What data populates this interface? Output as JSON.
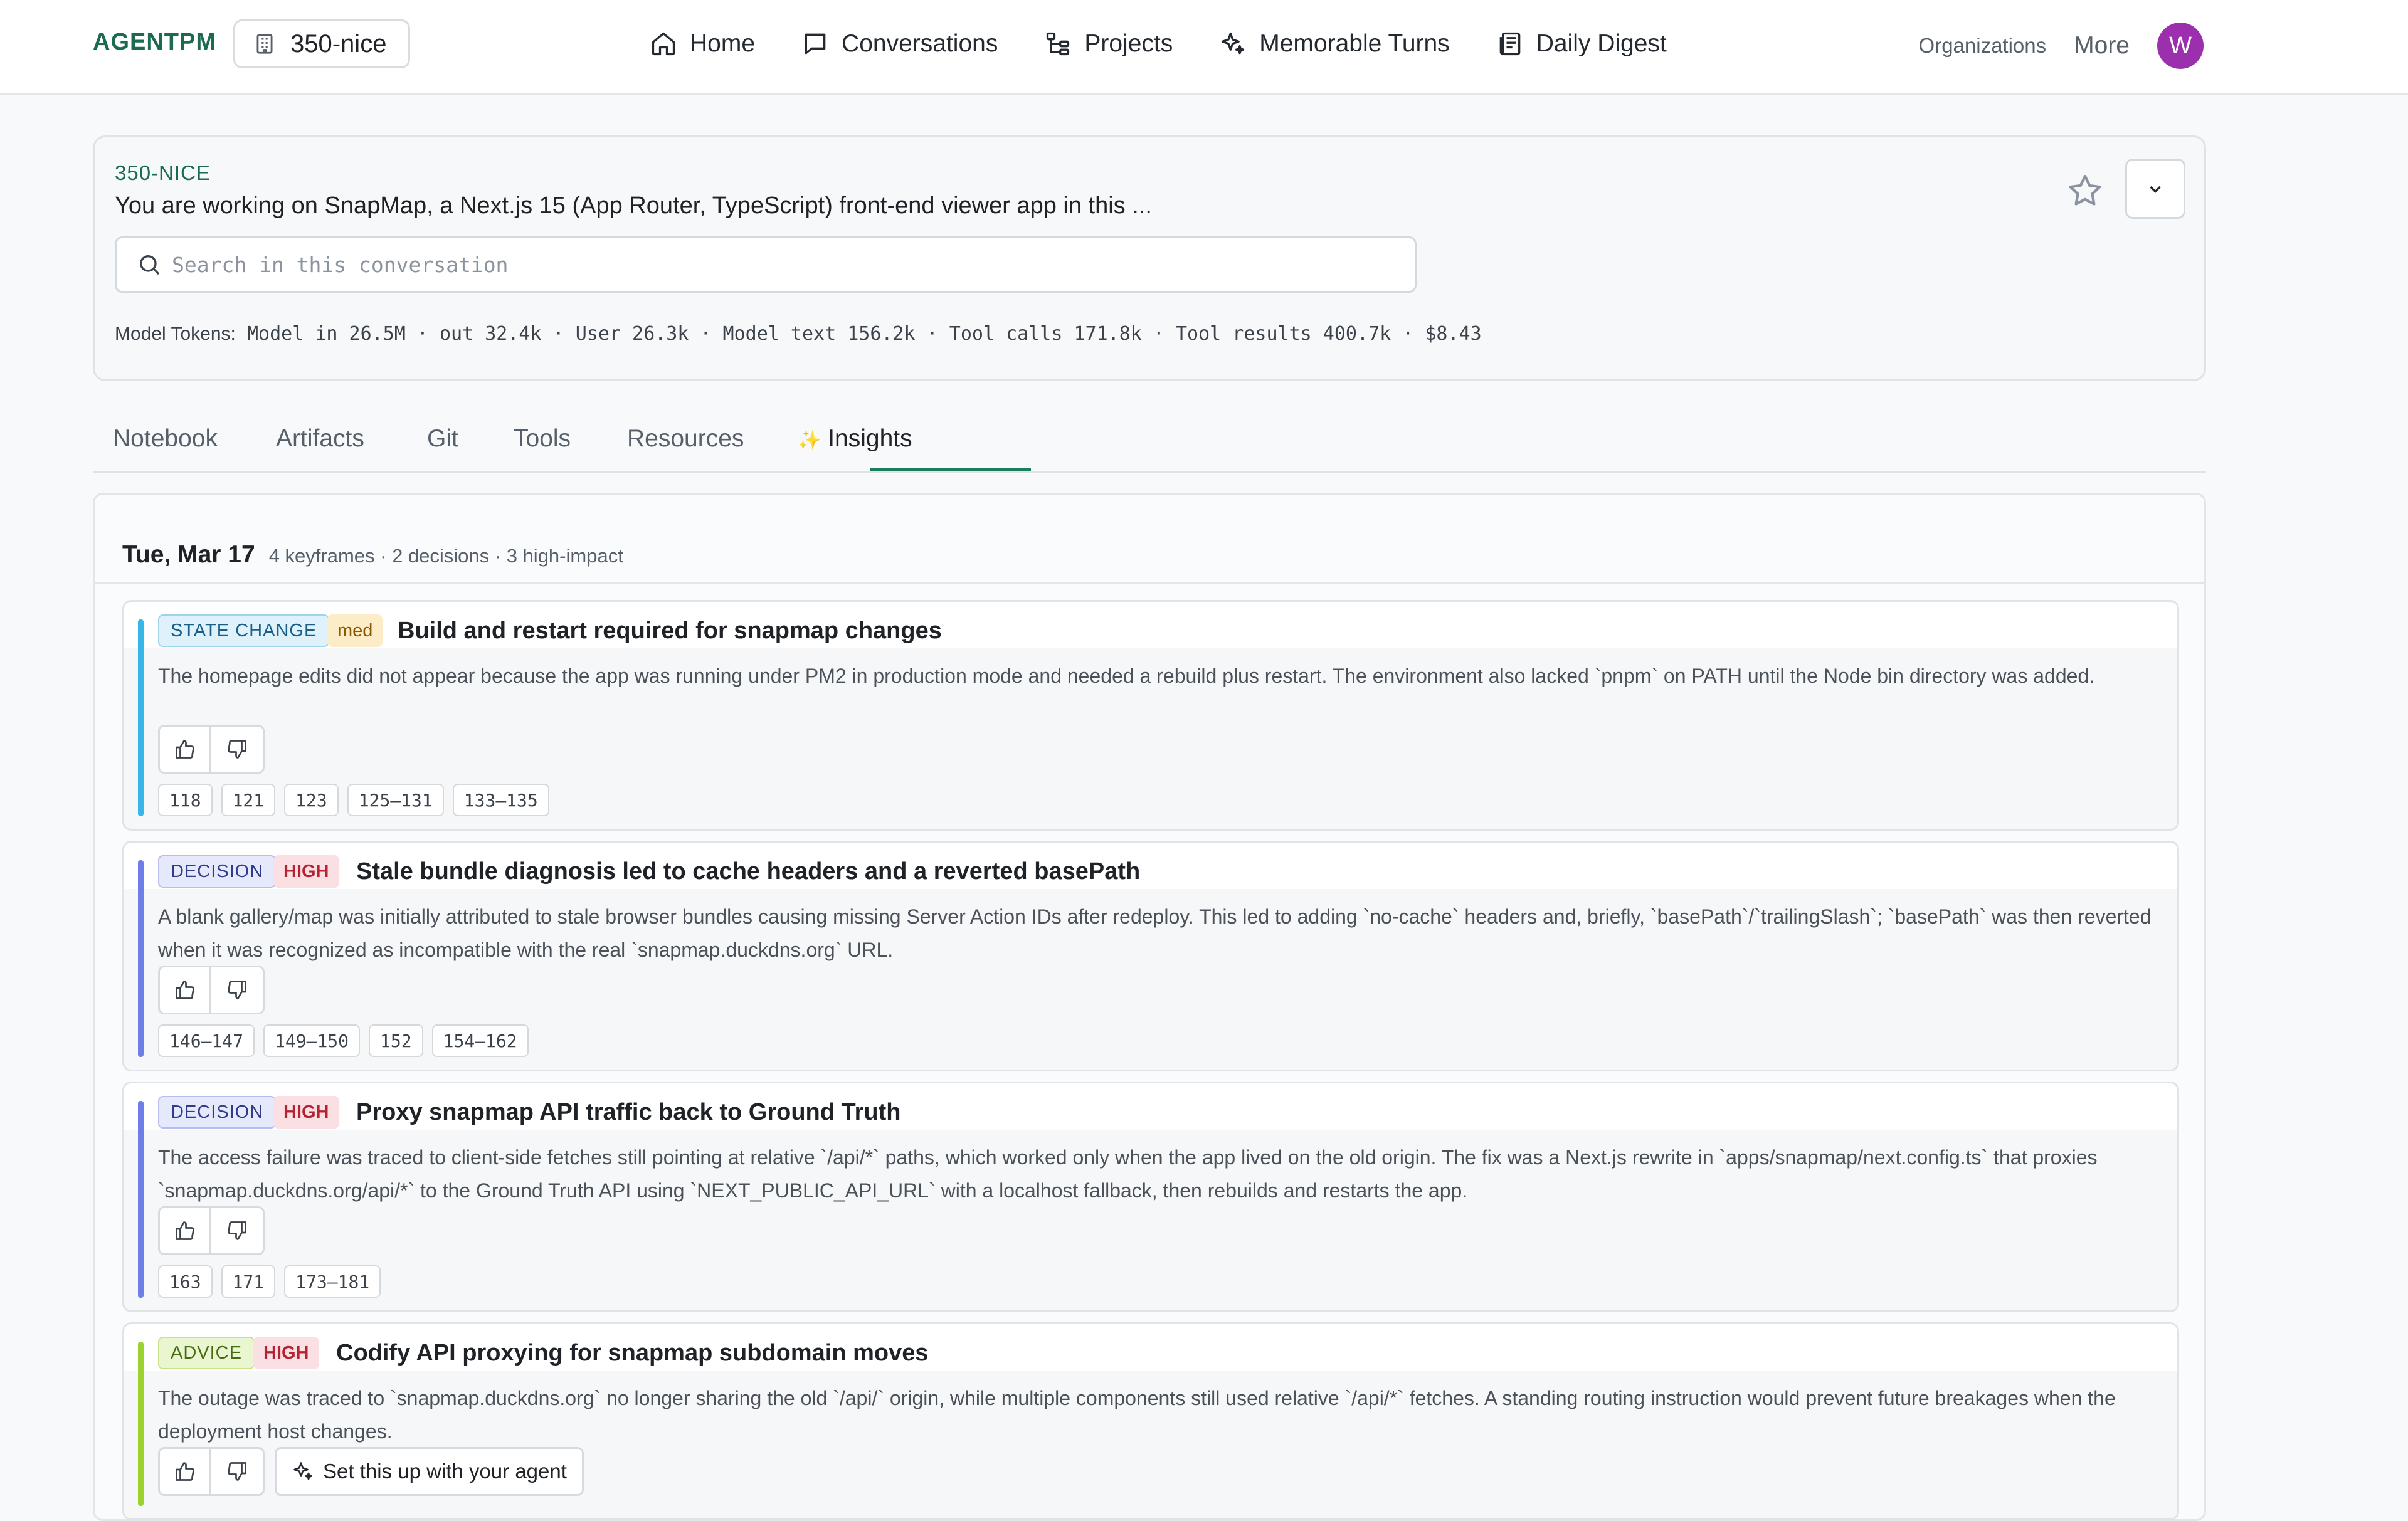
{
  "brand": "AGENTPM",
  "org": {
    "name": "350-nice"
  },
  "nav": {
    "home": "Home",
    "conversations": "Conversations",
    "projects": "Projects",
    "memorable": "Memorable Turns",
    "digest": "Daily Digest",
    "organizations": "Organizations",
    "more": "More",
    "avatar": "W"
  },
  "conversation": {
    "id": "350-NICE",
    "title": "You are working on SnapMap, a Next.js 15 (App Router, TypeScript) front-end viewer app in this ...",
    "search_placeholder": "Search in this conversation",
    "tokens_label": "Model Tokens:",
    "tokens_value": "Model in 26.5M · out 32.4k · User 26.3k · Model text 156.2k · Tool calls 171.8k · Tool results 400.7k",
    "cost": "$8.43"
  },
  "tabs": {
    "notebook": "Notebook",
    "artifacts": "Artifacts",
    "git": "Git",
    "tools": "Tools",
    "resources": "Resources",
    "insights": "Insights",
    "insights_icon": "✨"
  },
  "insights": {
    "day": "Tue, Mar 17",
    "meta": "4 keyframes · 2 decisions · 3 high-impact",
    "cards": [
      {
        "tag": "STATE CHANGE",
        "impact": "med",
        "title": "Build and restart required for snapmap changes",
        "description": "The homepage edits did not appear because the app was running under PM2 in production mode and needed a rebuild plus restart. The environment also lacked `pnpm` on PATH until the Node bin directory was added.",
        "refs": [
          "118",
          "121",
          "123",
          "125–131",
          "133–135"
        ]
      },
      {
        "tag": "DECISION",
        "impact": "HIGH",
        "title": "Stale bundle diagnosis led to cache headers and a reverted basePath",
        "description": "A blank gallery/map was initially attributed to stale browser bundles causing missing Server Action IDs after redeploy. This led to adding `no-cache` headers and, briefly, `basePath`/`trailingSlash`; `basePath` was then reverted when it was recognized as incompatible with the real `snapmap.duckdns.org` URL.",
        "refs": [
          "146–147",
          "149–150",
          "152",
          "154–162"
        ]
      },
      {
        "tag": "DECISION",
        "impact": "HIGH",
        "title": "Proxy snapmap API traffic back to Ground Truth",
        "description": "The access failure was traced to client-side fetches still pointing at relative `/api/*` paths, which worked only when the app lived on the old origin. The fix was a Next.js rewrite in `apps/snapmap/next.config.ts` that proxies `snapmap.duckdns.org/api/*` to the Ground Truth API using `NEXT_PUBLIC_API_URL` with a localhost fallback, then rebuilds and restarts the app.",
        "refs": [
          "163",
          "171",
          "173–181"
        ]
      },
      {
        "tag": "ADVICE",
        "impact": "HIGH",
        "title": "Codify API proxying for snapmap subdomain moves",
        "description": "The outage was traced to `snapmap.duckdns.org` no longer sharing the old `/api/` origin, while multiple components still used relative `/api/*` fetches. A standing routing instruction would prevent future breakages when the deployment host changes.",
        "action": "Set this up with your agent"
      }
    ]
  },
  "colors": {
    "state_bar": "#38b6e8",
    "decision_bar": "#6f7de8",
    "advice_bar": "#9bd22e",
    "brand": "#1a6b4f",
    "avatar": "#9b2fae"
  },
  "icons": {
    "org": "building-icon",
    "home": "home-icon",
    "conversations": "chat-icon",
    "projects": "tree-icon",
    "memorable": "sparkle-icon",
    "digest": "newspaper-icon",
    "search": "search-icon",
    "star": "star-icon",
    "dropdown": "chevron-down-icon",
    "thumbs_up": "thumbs-up-icon",
    "thumbs_down": "thumbs-down-icon"
  }
}
